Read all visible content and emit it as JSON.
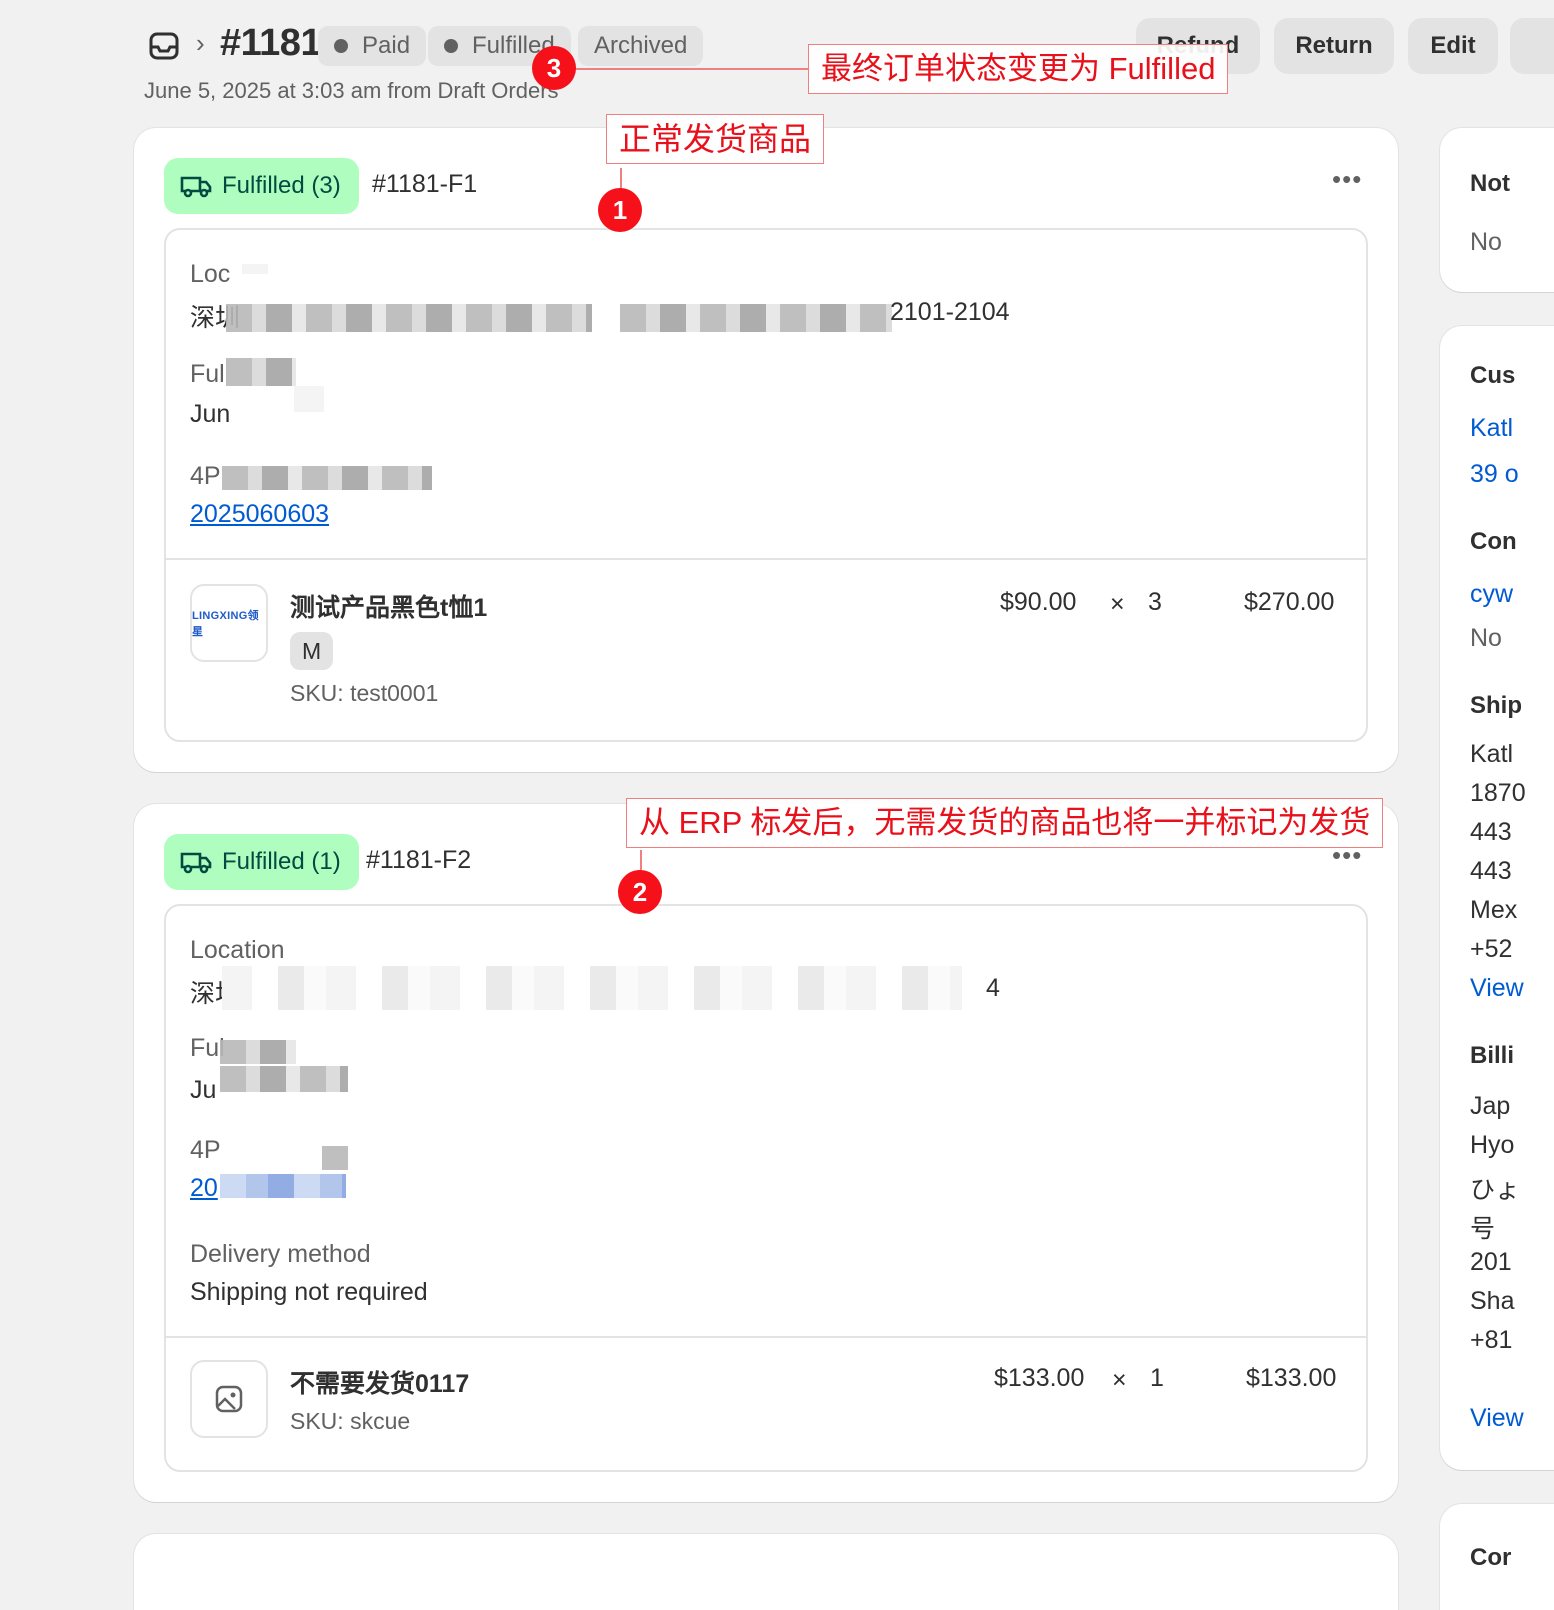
{
  "header": {
    "order_number": "#1181",
    "badges": [
      "Paid",
      "Fulfilled",
      "Archived"
    ],
    "subtitle": "June 5, 2025 at 3:03 am from Draft Orders",
    "buttons": [
      "Refund",
      "Return",
      "Edit"
    ]
  },
  "fulfillment1": {
    "badge": "Fulfilled (3)",
    "id": "#1181-F1",
    "location_label": "Loc",
    "location_value_prefix": "深圳",
    "location_value_suffix": "2101-2104",
    "fulfilled_label": "Ful",
    "fulfilled_value": "Jun",
    "carrier_label": "4P",
    "tracking": "2025060603",
    "item": {
      "name": "测试产品黑色t恤1",
      "variant": "M",
      "sku": "SKU: test0001",
      "unit_price": "$90.00",
      "times": "×",
      "qty": "3",
      "total": "$270.00",
      "thumb_text": "LINGXING领星"
    }
  },
  "fulfillment2": {
    "badge": "Fulfilled (1)",
    "id": "#1181-F2",
    "location_label": "Location",
    "location_value_prefix": "深圳",
    "location_value_suffix": "4",
    "fulfilled_label": "Ful",
    "fulfilled_value": "Ju",
    "carrier_label": "4P",
    "tracking": "20",
    "delivery_label": "Delivery method",
    "delivery_value": "Shipping not required",
    "item": {
      "name": "不需要发货0117",
      "sku": "SKU: skcue",
      "unit_price": "$133.00",
      "times": "×",
      "qty": "1",
      "total": "$133.00"
    }
  },
  "sidebar": {
    "notes_title": "Not",
    "notes_text": "No",
    "customer_title": "Cus",
    "customer_name": "Katl",
    "customer_orders": "39 o",
    "contact_title": "Con",
    "contact_email": "cyw",
    "contact_phone": "No",
    "shipping_title": "Ship",
    "shipping_lines": [
      "Katl",
      "1870",
      "443",
      "443",
      "Mex",
      "+52"
    ],
    "shipping_view": "View",
    "billing_title": "Billi",
    "billing_lines": [
      "Jap",
      "Hyo",
      "ひょ",
      "号",
      "201",
      "Sha",
      "+81"
    ],
    "billing_view": "View",
    "conversion_title": "Cor"
  },
  "annotations": {
    "a1": "正常发货商品",
    "a2": "从 ERP 标发后，无需发货的商品也将一并标记为发货",
    "a3": "最终订单状态变更为 Fulfilled",
    "n1": "1",
    "n2": "2",
    "n3": "3"
  }
}
